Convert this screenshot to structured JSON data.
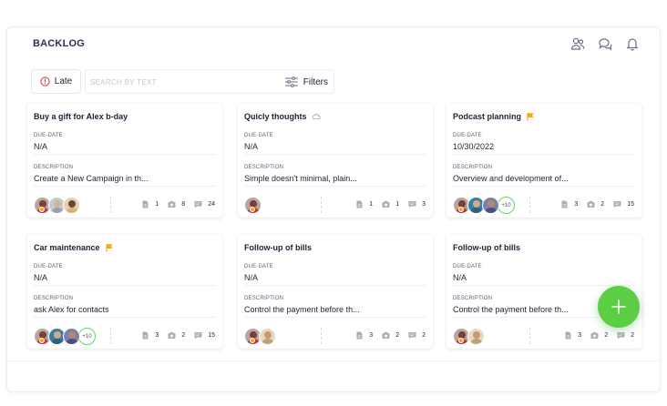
{
  "header": {
    "title": "BACKLOG",
    "icons": [
      "users-icon",
      "chat-icon",
      "bell-icon"
    ]
  },
  "toolbar": {
    "late_label": "Late",
    "search_placeholder": "SEARCH BY TEXT",
    "filters_label": "Filters"
  },
  "labels": {
    "due": "DUE-DATE",
    "desc": "DESCRIPTION"
  },
  "colors": {
    "accent_green": "#5bce45",
    "flag_orange": "#f5a623",
    "late_red": "#e0413b",
    "title_navy": "#2a3158"
  },
  "cards": [
    {
      "title": "Buy a gift for Alex b-day",
      "title_icon": null,
      "due_date": "N/A",
      "description": "Create a New Campaign in th...",
      "avatars": [
        "a1",
        "a2",
        "a3"
      ],
      "more": "",
      "status": "#f5a623",
      "counts": {
        "files": "1",
        "images": "8",
        "comments": "24"
      }
    },
    {
      "title": "Quicly thoughts",
      "title_icon": "cloud-icon",
      "due_date": "N/A",
      "description": "Simple doesn't minimal, plain...",
      "avatars": [
        "a1"
      ],
      "more": "",
      "status": "#f5a623",
      "counts": {
        "files": "1",
        "images": "1",
        "comments": "3"
      }
    },
    {
      "title": "Podcast planning",
      "title_icon": "flag-icon",
      "due_date": "10/30/2022",
      "description": "Overview and development of...",
      "avatars": [
        "a1",
        "a4",
        "a5"
      ],
      "more": "+10",
      "status": "#f5a623",
      "counts": {
        "files": "3",
        "images": "2",
        "comments": "15"
      }
    },
    {
      "title": "Car maintenance",
      "title_icon": "flag-icon",
      "due_date": "N/A",
      "description": "ask Alex for contacts",
      "avatars": [
        "a1",
        "a4",
        "a5"
      ],
      "more": "+10",
      "status": "#f5a623",
      "counts": {
        "files": "3",
        "images": "2",
        "comments": "15"
      }
    },
    {
      "title": "Follow-up of bills",
      "title_icon": null,
      "due_date": "N/A",
      "description": "Control the payment before th...",
      "avatars": [
        "a1",
        "a6"
      ],
      "more": "",
      "status": "#f5a623",
      "counts": {
        "files": "3",
        "images": "2",
        "comments": "2"
      }
    },
    {
      "title": "Follow-up of bills",
      "title_icon": null,
      "due_date": "N/A",
      "description": "Control the payment before th...",
      "avatars": [
        "a1",
        "a6"
      ],
      "more": "",
      "status": "#f5a623",
      "counts": {
        "files": "3",
        "images": "2",
        "comments": "2"
      }
    }
  ]
}
